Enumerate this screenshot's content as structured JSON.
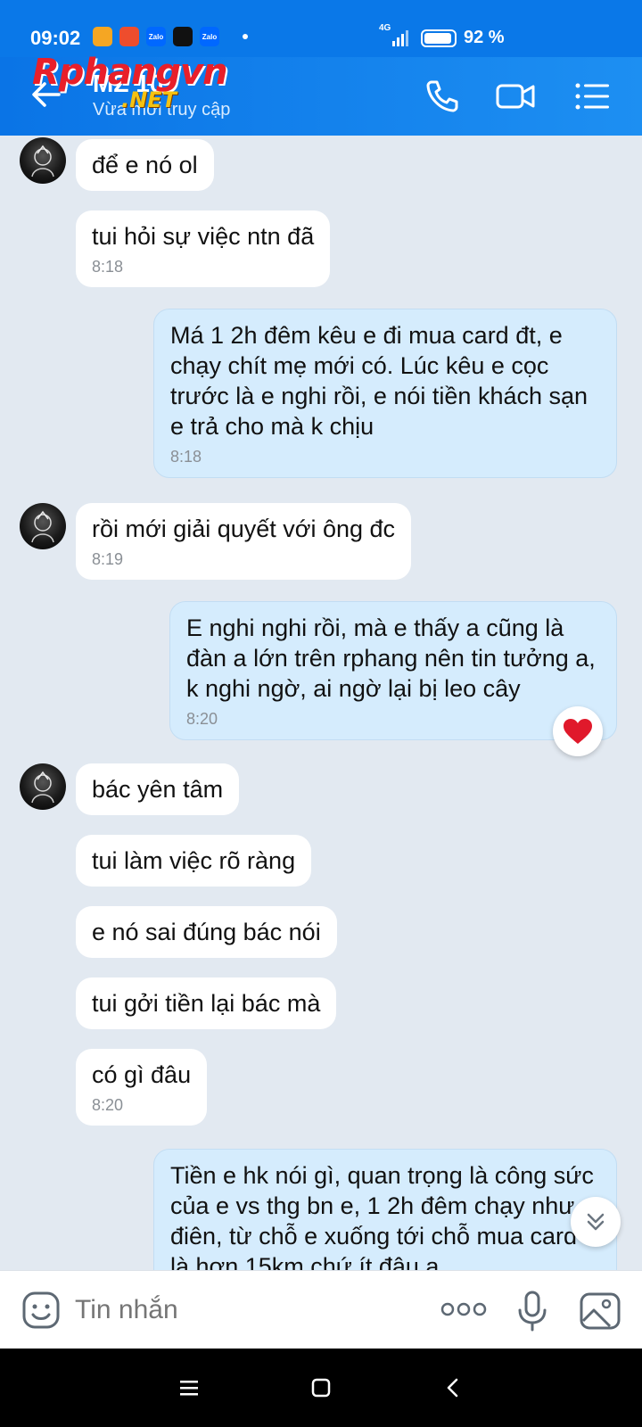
{
  "status_bar": {
    "time": "09:02",
    "apps": [
      "Zalo",
      "Zalo"
    ],
    "network": "4G",
    "battery": "92 %"
  },
  "header": {
    "contact_name": "MZ 10",
    "status": "Vừa mới truy cập",
    "watermark_top": "Rphangvn",
    "watermark_bottom": ".NET",
    "icons": [
      "back-arrow-icon",
      "phone-icon",
      "video-call-icon",
      "menu-icon"
    ]
  },
  "messages": [
    {
      "side": "in",
      "avatar": true,
      "text": "để e nó ol",
      "time": ""
    },
    {
      "side": "in",
      "avatar": false,
      "text": "tui hỏi sự việc ntn đã",
      "time": "8:18"
    },
    {
      "side": "out",
      "text": "Má 1 2h đêm kêu e đi mua card đt, e chạy chít mẹ mới có. Lúc kêu e cọc trước là e nghi rồi, e nói tiền khách sạn e trả cho mà k chịu",
      "time": "8:18"
    },
    {
      "side": "in",
      "avatar": true,
      "text": "rồi mới giải quyết với ông đc",
      "time": "8:19"
    },
    {
      "side": "out",
      "text": "E nghi nghi rồi, mà e thấy a cũng là đàn a lớn trên rphang nên tin tưởng a, k nghi ngờ, ai ngờ lại bị leo cây",
      "time": "8:20",
      "reaction": "heart-icon"
    },
    {
      "side": "in",
      "avatar": true,
      "text": "bác yên tâm",
      "time": ""
    },
    {
      "side": "in",
      "avatar": false,
      "text": "tui làm việc rõ ràng",
      "time": ""
    },
    {
      "side": "in",
      "avatar": false,
      "text": "e nó sai đúng bác nói",
      "time": ""
    },
    {
      "side": "in",
      "avatar": false,
      "text": "tui gởi tiền lại bác mà",
      "time": ""
    },
    {
      "side": "in",
      "avatar": false,
      "text": "có gì đâu",
      "time": "8:20"
    },
    {
      "side": "out",
      "text": "Tiền e hk nói gì, quan trọng là công sức của e vs thg bn e, 1 2h đêm chạy như điên, từ chỗ e xuống tới chỗ mua card là hơn 15km chứ ít đâu a",
      "time": ""
    }
  ],
  "input": {
    "placeholder": "Tin nhắn"
  },
  "colors": {
    "header": "#0a78e8",
    "outgoing_bubble": "#d5ecfd",
    "incoming_bubble": "#ffffff",
    "chat_bg": "#e2e9f1"
  }
}
